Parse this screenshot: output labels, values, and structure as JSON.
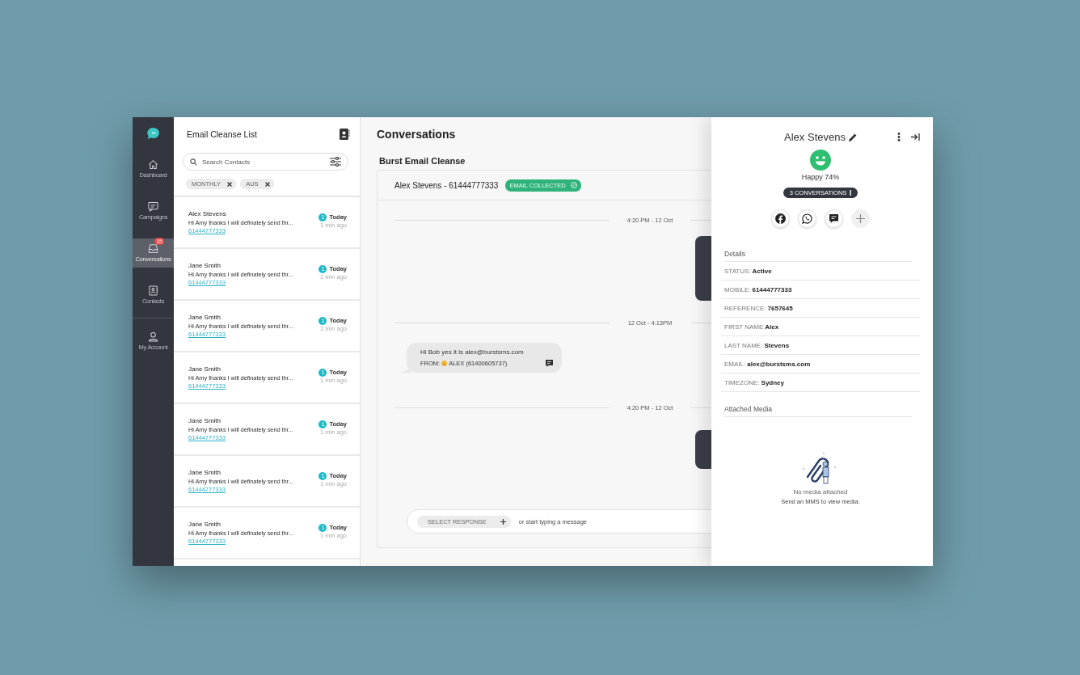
{
  "nav": {
    "items": [
      {
        "label": "Dashboard",
        "selected": false
      },
      {
        "label": "Campaigns",
        "selected": false
      },
      {
        "label": "Conversations",
        "selected": true,
        "badge": "15"
      },
      {
        "label": "Contacts",
        "selected": false
      },
      {
        "label": "My Account",
        "selected": false
      }
    ]
  },
  "list": {
    "title": "Email Cleanse List",
    "search": {
      "placeholder": "Search Contacts"
    },
    "chips": [
      {
        "label": "MONTHLY"
      },
      {
        "label": "AUS"
      }
    ],
    "conversations": [
      {
        "name": "Alex Stevens",
        "preview": "Hi Amy thanks I will definately send thr...",
        "phone": "61444777333",
        "unread": "1",
        "day": "Today",
        "ago": "1 min ago"
      },
      {
        "name": "Jane Smith",
        "preview": "Hi Amy thanks I will definately send thr...",
        "phone": "61444777333",
        "unread": "1",
        "day": "Today",
        "ago": "1 min ago"
      },
      {
        "name": "Jane Smith",
        "preview": "Hi Amy thanks I will definately send thr...",
        "phone": "61444777333",
        "unread": "1",
        "day": "Today",
        "ago": "1 min ago"
      },
      {
        "name": "Jane Smith",
        "preview": "Hi Amy thanks I will definately send thr...",
        "phone": "61444777333",
        "unread": "1",
        "day": "Today",
        "ago": "1 min ago"
      },
      {
        "name": "Jane Smith",
        "preview": "Hi Amy thanks I will definately send thr...",
        "phone": "61444777333",
        "unread": "1",
        "day": "Today",
        "ago": "1 min ago"
      },
      {
        "name": "Jane Smith",
        "preview": "Hi Amy thanks I will definately send thr...",
        "phone": "61444777333",
        "unread": "1",
        "day": "Today",
        "ago": "1 min ago"
      },
      {
        "name": "Jane Smith",
        "preview": "Hi Amy thanks I will definately send thr...",
        "phone": "61444777333",
        "unread": "1",
        "day": "Today",
        "ago": "1 min ago"
      }
    ]
  },
  "main": {
    "title": "Conversations",
    "campaign": "Burst Email Cleanse",
    "thread": {
      "title": "Alex Stevens - 61444777333",
      "badge": "EMAIL COLLECTED",
      "items": [
        {
          "kind": "divider",
          "time": "4:20 PM - 12 Oct"
        },
        {
          "kind": "outgoing"
        },
        {
          "kind": "divider",
          "time": "12 Oct - 4:13PM"
        },
        {
          "kind": "incoming",
          "text": "Hi Bob yes it is alex@burstsms.com",
          "from_label": "FROM:",
          "from": "ALEX (61400605737)"
        },
        {
          "kind": "divider",
          "time": "4:20 PM - 12 Oct"
        },
        {
          "kind": "outgoing"
        }
      ]
    },
    "composer": {
      "button": "SELECT RESPONSE",
      "placeholder": "or start typing a message"
    }
  },
  "contact": {
    "name": "Alex Stevens",
    "mood": "Happy 74%",
    "conversations": "3 CONVERSATIONS",
    "details_title": "Details",
    "details": [
      {
        "label": "STATUS:",
        "value": "Active"
      },
      {
        "label": "MOBILE:",
        "value": "61444777333"
      },
      {
        "label": "REFERENCE:",
        "value": "7657645"
      },
      {
        "label": "FIRST NAME",
        "value": "Alex"
      },
      {
        "label": "LAST NAME:",
        "value": "Stevens"
      },
      {
        "label": "EMAIL:",
        "value": "alex@burstsms.com"
      },
      {
        "label": "TIMEZONE:",
        "value": "Sydney"
      }
    ],
    "media_title": "Attached Media",
    "empty_title": "No media attached",
    "empty_hint": "Send an MMS to view media."
  }
}
